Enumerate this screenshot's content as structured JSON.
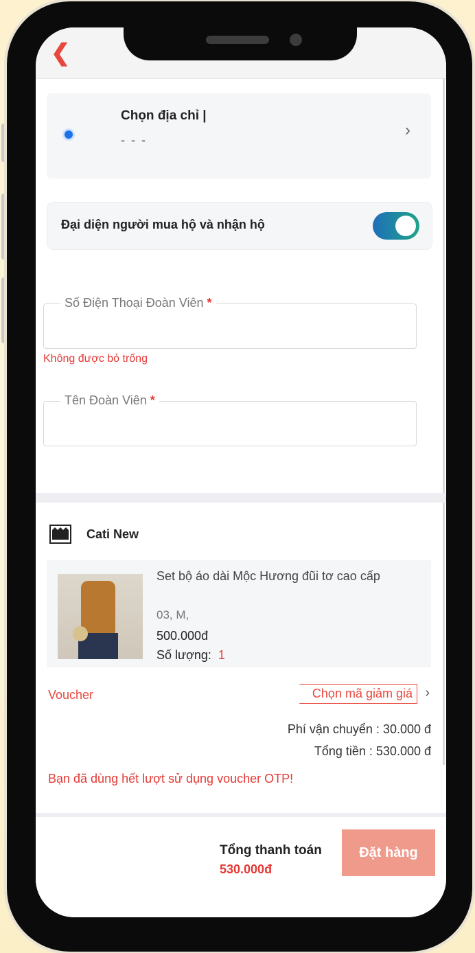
{
  "header": {
    "back_icon": "chevron-left-icon"
  },
  "address": {
    "title": "Chọn địa chỉ |",
    "subtitle": "- - -",
    "chevron_icon": "chevron-right-icon"
  },
  "representative": {
    "label": "Đại diện người mua hộ và nhận hộ",
    "toggle_on": true
  },
  "form": {
    "phone_label": "Số Điện Thoại Đoàn Viên",
    "phone_value": "",
    "phone_error": "Không được bỏ trống",
    "name_label": "Tên Đoàn Viên",
    "name_value": "",
    "required_mark": "*"
  },
  "shop": {
    "name": "Cati New",
    "icon": "shop-icon"
  },
  "product": {
    "name": "Set bộ áo dài Mộc Hương đũi tơ cao cấp",
    "variant": "03, M,",
    "price": "500.000đ",
    "qty_label": "Số lượng:",
    "qty_value": "1"
  },
  "voucher": {
    "label": "Voucher",
    "button": "Chọn mã giảm giá",
    "chevron_icon": "chevron-right-icon"
  },
  "summary": {
    "shipping": "Phí vận chuyển : 30.000 đ",
    "total": "Tổng tiền : 530.000 đ",
    "warning": "Bạn đã dùng hết lượt sử dụng voucher OTP!"
  },
  "footer": {
    "pay_label": "Tổng thanh toán",
    "pay_value": "530.000đ",
    "order_button": "Đặt hàng"
  },
  "colors": {
    "accent": "#e8473c",
    "error": "#e53935",
    "button_disabled": "#ef9a8a",
    "toggle": "#1f6fb8"
  }
}
